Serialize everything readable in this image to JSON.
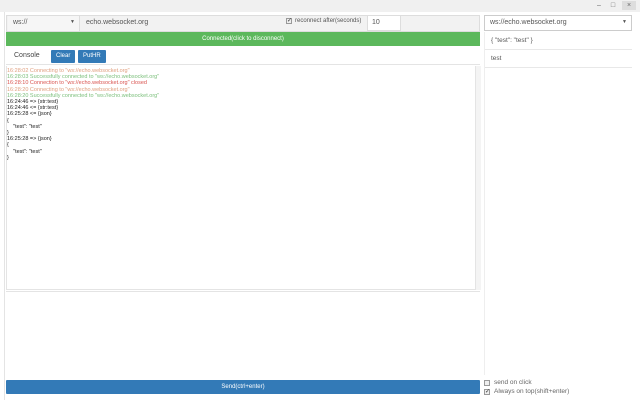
{
  "window": {
    "minimize": "–",
    "maximize": "□",
    "close": "×"
  },
  "connection": {
    "protocol": "ws://",
    "host": "echo.websocket.org",
    "reconnect_checked": true,
    "reconnect_label": "reconnect after(seconds)",
    "reconnect_seconds": "10",
    "status": "Connected(click to disconnect)"
  },
  "toolbar": {
    "console_tab": "Console",
    "clear": "Clear",
    "pause": "PutHR"
  },
  "log": [
    {
      "cls": "o",
      "text": "16:28:02 Connecting to \"ws://echo.websocket.org\""
    },
    {
      "cls": "g",
      "text": "16:28:03 Successfully connected to \"ws://echo.websocket.org\""
    },
    {
      "cls": "r",
      "text": "16:28:10 Connection to \"ws://echo.websocket.org\" closed"
    },
    {
      "cls": "o",
      "text": "16:28:20 Connecting to \"ws://echo.websocket.org\""
    },
    {
      "cls": "g",
      "text": "16:28:20 Successfully connected to \"ws://echo.websocket.org\""
    },
    {
      "cls": "k",
      "text": "16:24:46 => {str:test}"
    },
    {
      "cls": "k",
      "text": "16:24:46 <= {str:test}"
    },
    {
      "cls": "k",
      "text": "16:25:28 <= {json}"
    },
    {
      "cls": "k",
      "text": "{"
    },
    {
      "cls": "k",
      "text": "    \"test\": \"test\""
    },
    {
      "cls": "k",
      "text": "}"
    },
    {
      "cls": "k",
      "text": "16:25:28 => {json}"
    },
    {
      "cls": "k",
      "text": "{"
    },
    {
      "cls": "k",
      "text": "    \"test\": \"test\""
    },
    {
      "cls": "k",
      "text": "}"
    }
  ],
  "send_label": "Send(ctrl+enter)",
  "history": {
    "url": "ws://echo.websocket.org",
    "items": [
      "{ \"test\": \"test\" }",
      "test"
    ]
  },
  "options": {
    "send_on_click": "send on click",
    "send_on_click_checked": false,
    "always_on_top": "Always on top(shift+enter)",
    "always_on_top_checked": true
  }
}
